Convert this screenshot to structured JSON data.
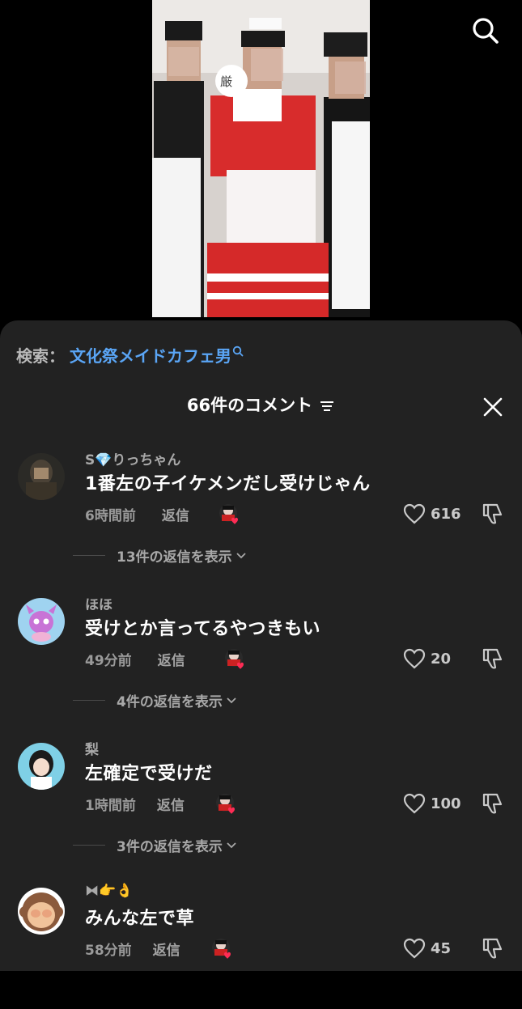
{
  "search": {
    "label": "検索：",
    "term": "文化祭メイドカフェ男"
  },
  "comments_header": {
    "title": "66件のコメント"
  },
  "icons": {
    "top_search": "search-icon",
    "filter": "filter-lines-icon",
    "close": "close-icon",
    "like": "heart-outline-icon",
    "dislike": "thumbs-down-icon",
    "chevron": "chevron-down-icon"
  },
  "colors": {
    "sheet_bg": "#222222",
    "search_term": "#5aa5f5",
    "creator_like_heart": "#fe2c55"
  },
  "comments": [
    {
      "username": "S💎りっちゃん",
      "text": "1番左の子イケメンだし受けじゃん",
      "time": "6時間前",
      "reply_label": "返信",
      "likes": "616",
      "view_replies": "13件の返信を表示"
    },
    {
      "username": "ほほ",
      "text": "受けとか言ってるやつきもい",
      "time": "49分前",
      "reply_label": "返信",
      "likes": "20",
      "view_replies": "4件の返信を表示"
    },
    {
      "username": "梨",
      "text": "左確定で受けだ",
      "time": "1時間前",
      "reply_label": "返信",
      "likes": "100",
      "view_replies": "3件の返信を表示"
    },
    {
      "username": "⧓👉👌",
      "text": "みんな左で草",
      "time": "58分前",
      "reply_label": "返信",
      "likes": "45"
    }
  ]
}
